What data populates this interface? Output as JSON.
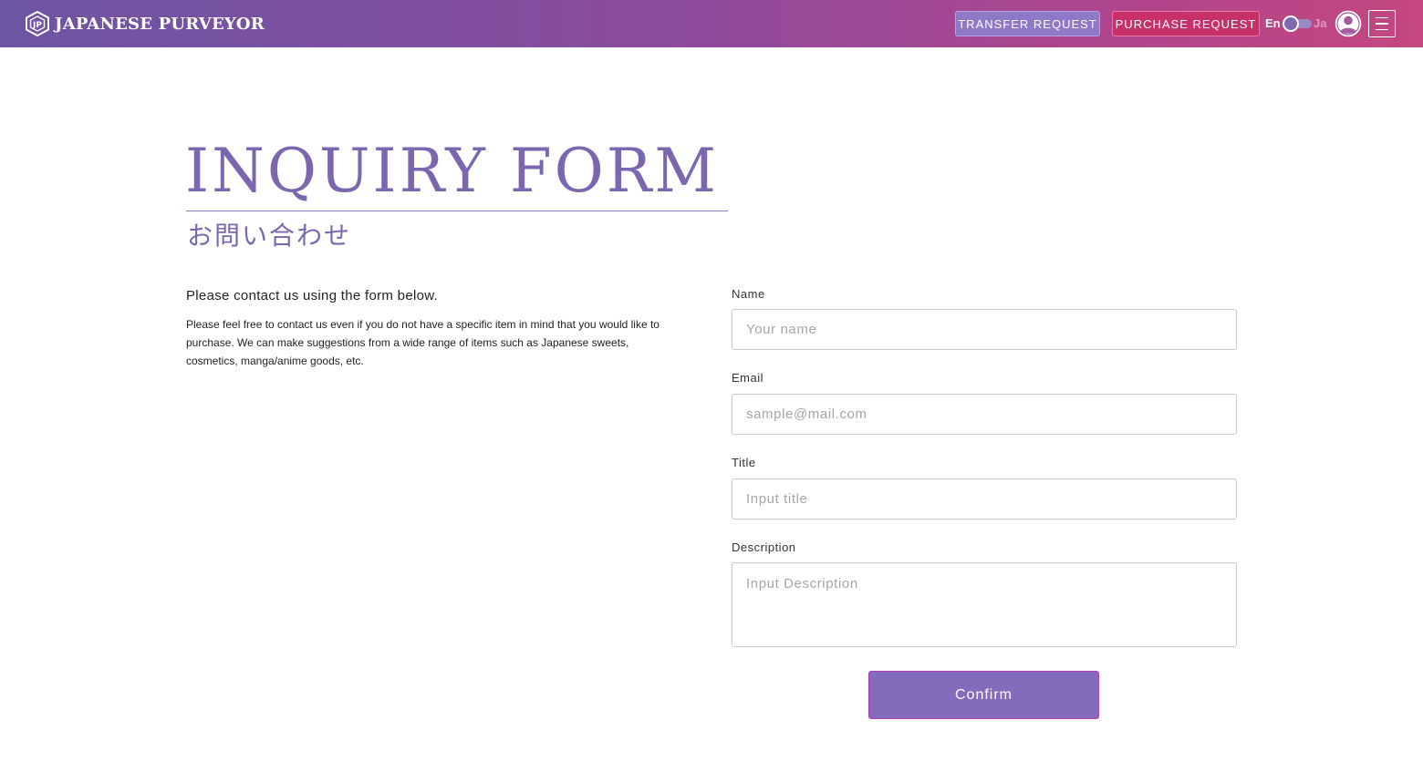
{
  "header": {
    "brand": "JAPANESE PURVEYOR",
    "transfer_request": "TRANSFER REQUEST",
    "purchase_request": "PURCHASE REQUEST",
    "lang_en": "En",
    "lang_ja": "Ja",
    "language_selected": "En",
    "icons": [
      "brand-logo-icon",
      "user-avatar-icon",
      "hamburger-menu-icon"
    ]
  },
  "page": {
    "title_en": "INQUIRY FORM",
    "title_ja": "お問い合わせ",
    "intro_lead": "Please contact us using the form below.",
    "intro_body": "Please feel free to contact us even if you do not have a specific item in mind that you would like to purchase. We can make suggestions from a wide range of items such as Japanese sweets, cosmetics, manga/anime goods, etc."
  },
  "form": {
    "name": {
      "label": "Name",
      "value": "",
      "placeholder": "Your name"
    },
    "email": {
      "label": "Email",
      "value": "",
      "placeholder": "sample@mail.com"
    },
    "title": {
      "label": "Title",
      "value": "",
      "placeholder": "Input title"
    },
    "description": {
      "label": "Description",
      "value": "",
      "placeholder": "Input Description"
    },
    "confirm": "Confirm"
  },
  "colors": {
    "header_gradient_start": "#6d55a3",
    "header_gradient_end": "#c4477f",
    "accent_purple": "#7a67b0",
    "transfer_button": "#8e79c6",
    "purchase_button": "#c8306a",
    "confirm_button": "#846cbc"
  }
}
